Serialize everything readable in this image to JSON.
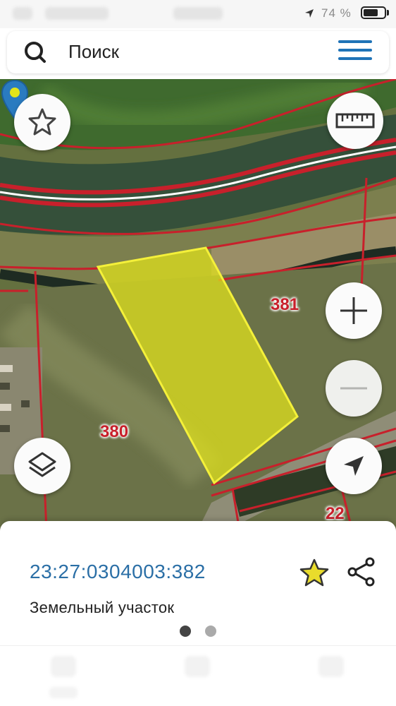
{
  "status_bar": {
    "battery_text": "74 %",
    "battery_level": 0.74,
    "location_icon": "location-arrow-icon"
  },
  "search": {
    "placeholder": "Поиск",
    "icon": "search-icon",
    "menu_icon": "hamburger-menu-icon"
  },
  "map": {
    "parcel_labels": [
      "381",
      "380",
      "22"
    ],
    "selected_parcel_color": "#e3e41a",
    "boundary_color": "#c8202b",
    "pin_color": "#2a7bc0",
    "controls": [
      "favorites-star-icon",
      "ruler-icon",
      "zoom-in-icon",
      "zoom-out-icon",
      "layers-icon",
      "my-location-icon"
    ]
  },
  "sheet": {
    "cadastral_number": "23:27:0304003:382",
    "object_type": "Земельный участок",
    "favorite_icon": "star-icon",
    "share_icon": "share-icon",
    "accent_color": "#2b6fa6",
    "page_dots": 2,
    "active_dot": 0
  }
}
